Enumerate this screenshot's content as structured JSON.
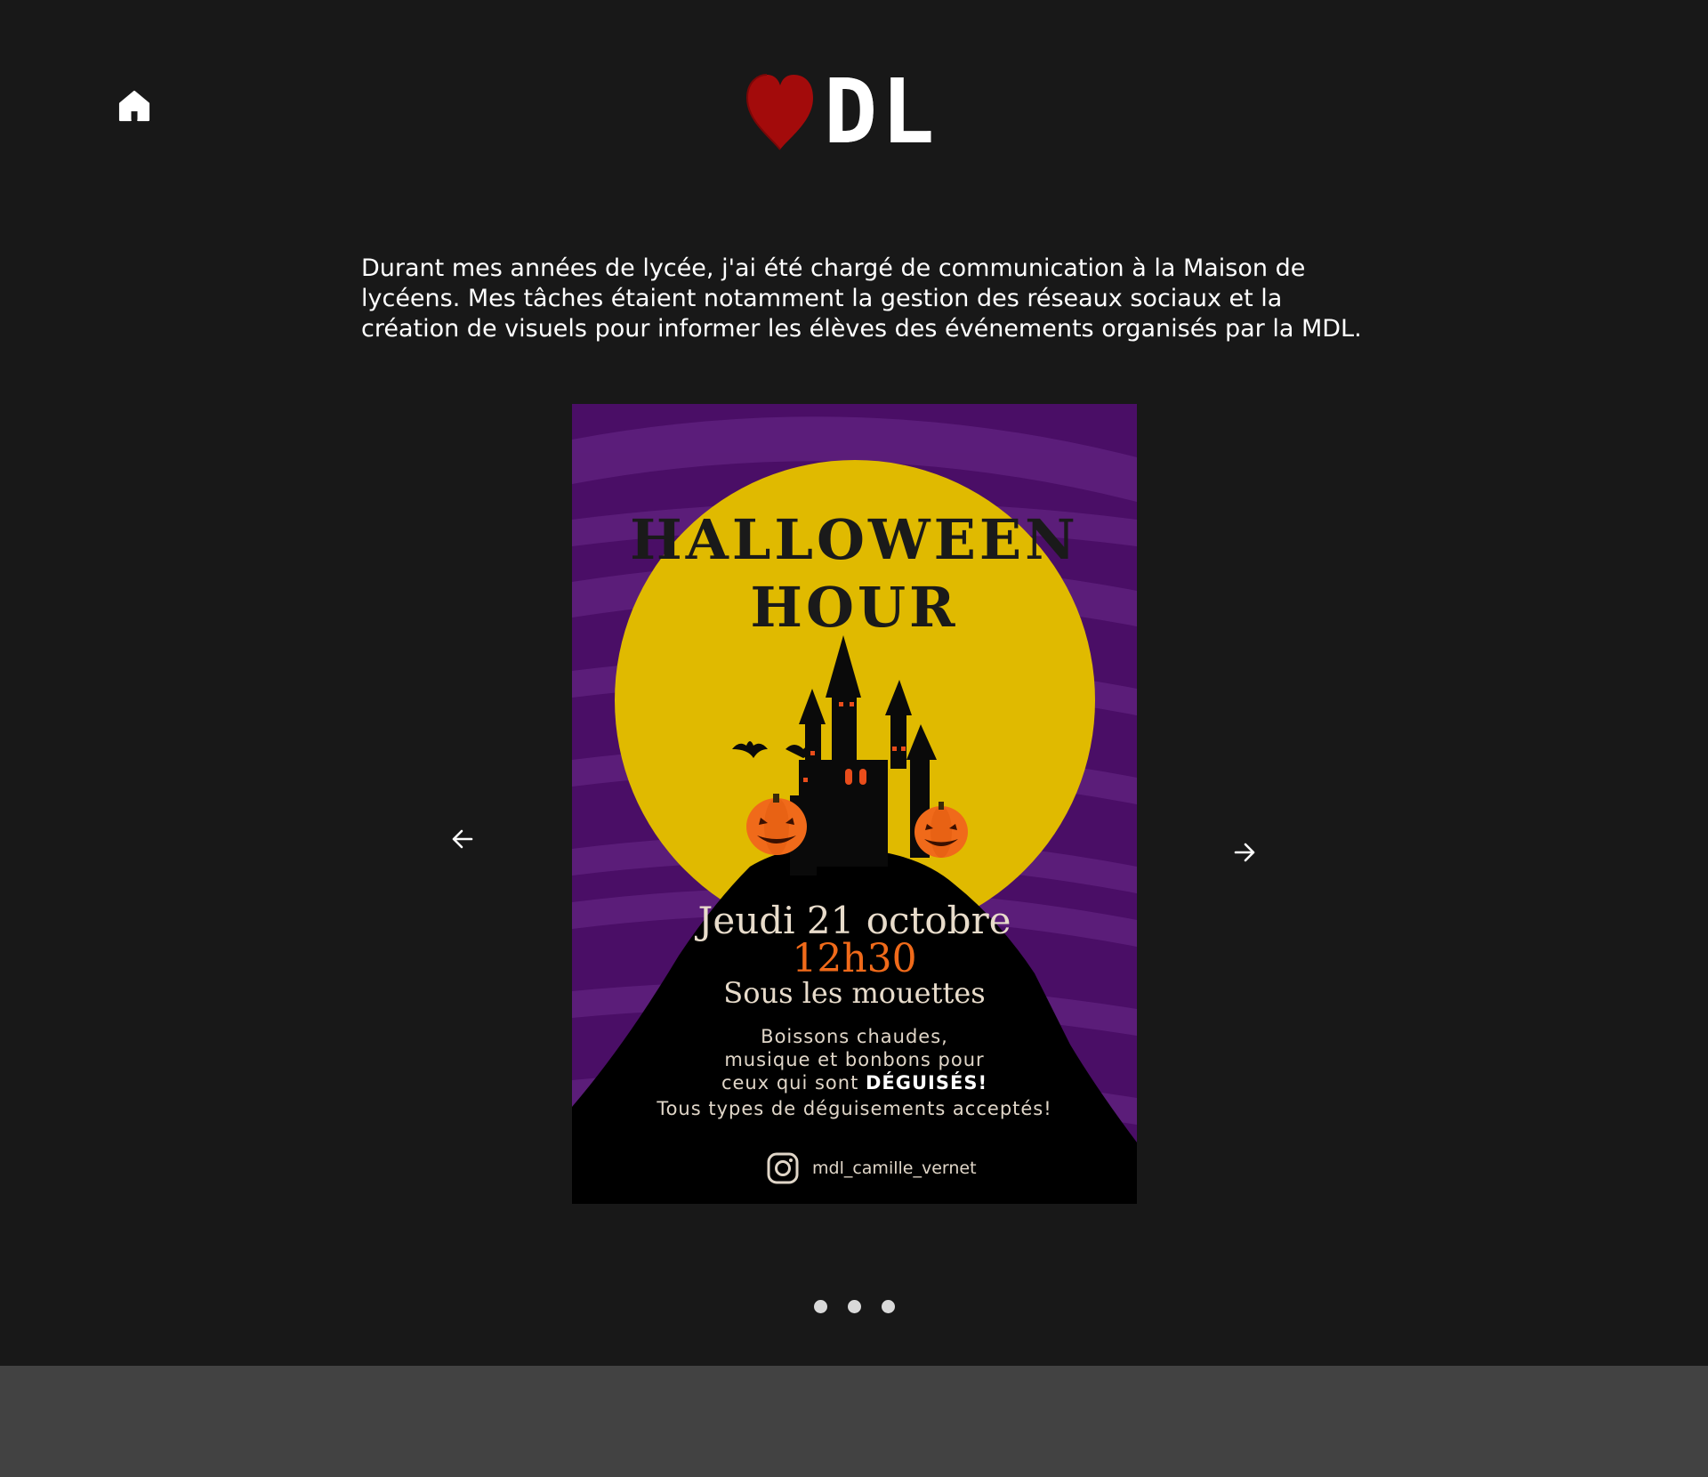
{
  "header": {
    "home_icon": "home-icon",
    "logo": {
      "icon": "heart-icon",
      "text": "DL",
      "heart_color": "#a30b0b"
    }
  },
  "intro": {
    "text": "Durant mes années de lycée, j'ai été chargé de communication à la Maison de lycéens. Mes tâches étaient notamment la gestion des réseaux sociaux et la création de visuels pour informer les élèves des événements organisés par la MDL."
  },
  "carousel": {
    "prev_icon": "arrow-left-icon",
    "next_icon": "arrow-right-icon",
    "slide_count": 3,
    "poster": {
      "title_line1": "HALLOWEEN",
      "title_line2": "HOUR",
      "date": "Jeudi 21 octobre",
      "time": "12h30",
      "place": "Sous les mouettes",
      "desc_line1": "Boissons chaudes,",
      "desc_line2": "musique et bonbons pour",
      "desc_line3a": "ceux qui sont ",
      "desc_line3b": "DÉGUISÉS!",
      "accept": "Tous types de déguisements acceptés!",
      "instagram_handle": "mdl_camille_vernet",
      "colors": {
        "background": "#4a0e66",
        "moon": "#e0ba00",
        "accent": "#f06a1a"
      }
    }
  },
  "colors": {
    "page_bg": "#181818",
    "footer_bg": "#424242"
  }
}
